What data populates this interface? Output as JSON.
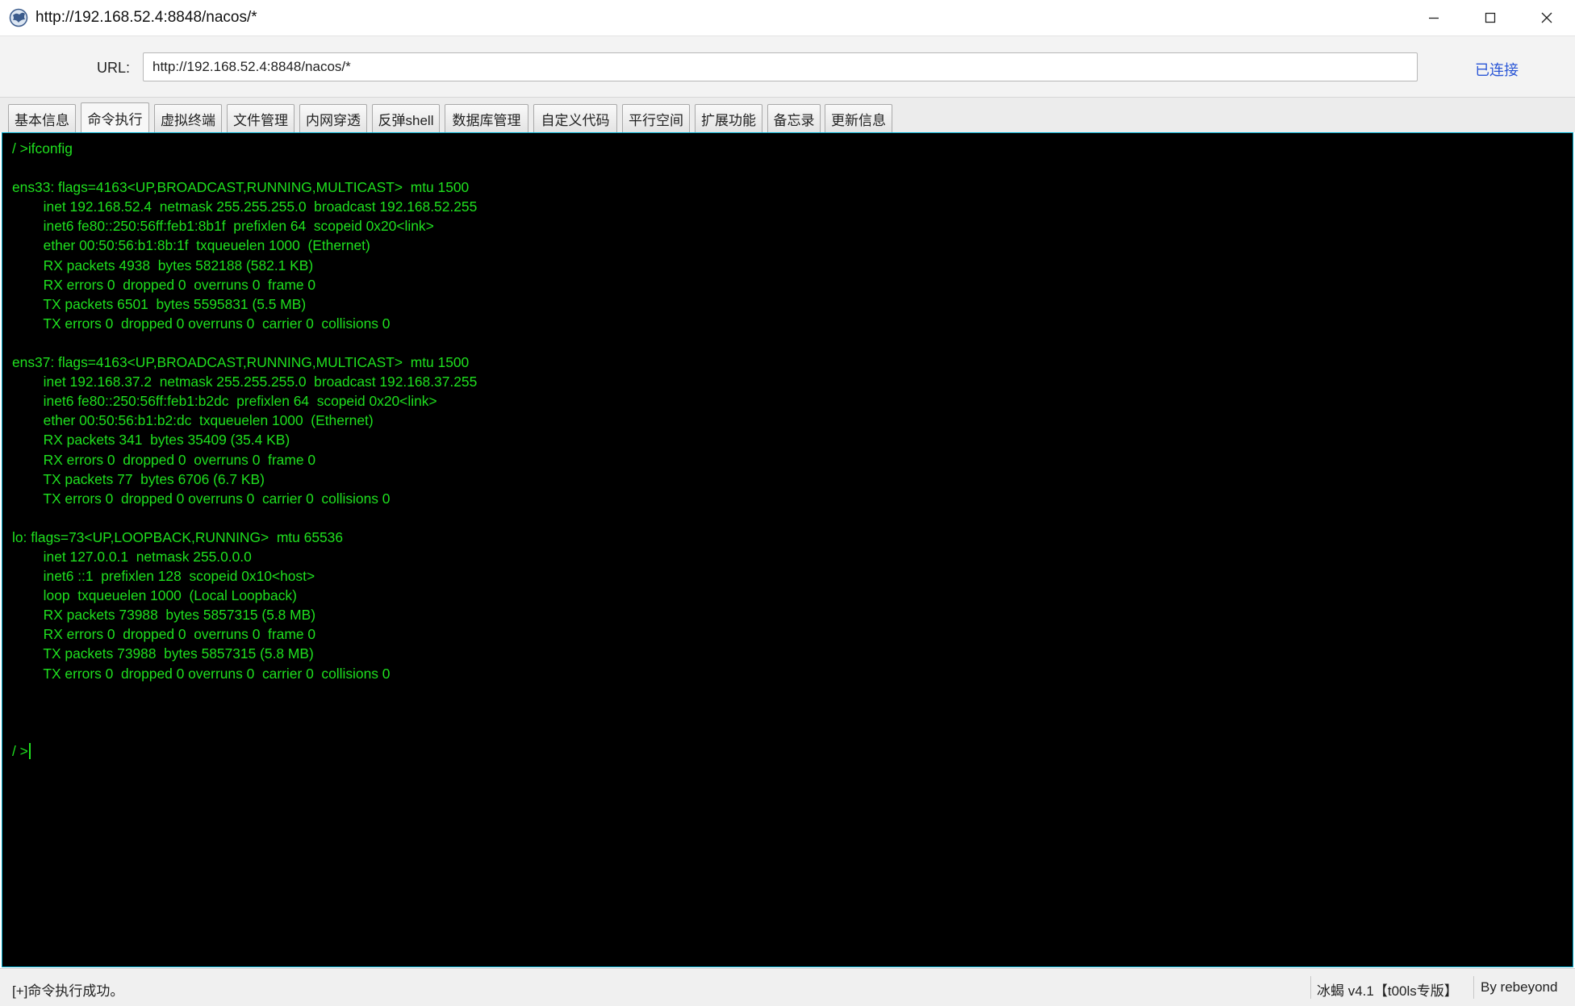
{
  "window": {
    "title": "http://192.168.52.4:8848/nacos/*",
    "icons": {
      "app": "behinder-app-icon",
      "minimize": "minimize-icon",
      "maximize": "maximize-icon",
      "close": "close-icon"
    }
  },
  "url_bar": {
    "label": "URL:",
    "value": "http://192.168.52.4:8848/nacos/*",
    "status": "已连接",
    "status_color": "#2a56d6"
  },
  "tabs": [
    {
      "label": "基本信息"
    },
    {
      "label": "命令执行",
      "active": true
    },
    {
      "label": "虚拟终端"
    },
    {
      "label": "文件管理"
    },
    {
      "label": "内网穿透"
    },
    {
      "label": "反弹shell"
    },
    {
      "label": "数据库管理"
    },
    {
      "label": "自定义代码"
    },
    {
      "label": "平行空间"
    },
    {
      "label": "扩展功能"
    },
    {
      "label": "备忘录"
    },
    {
      "label": "更新信息"
    }
  ],
  "terminal": {
    "text_color": "#1fe01f",
    "background": "#000000",
    "command_line": "/ >ifconfig",
    "output": [
      "",
      "ens33: flags=4163<UP,BROADCAST,RUNNING,MULTICAST>  mtu 1500",
      "        inet 192.168.52.4  netmask 255.255.255.0  broadcast 192.168.52.255",
      "        inet6 fe80::250:56ff:feb1:8b1f  prefixlen 64  scopeid 0x20<link>",
      "        ether 00:50:56:b1:8b:1f  txqueuelen 1000  (Ethernet)",
      "        RX packets 4938  bytes 582188 (582.1 KB)",
      "        RX errors 0  dropped 0  overruns 0  frame 0",
      "        TX packets 6501  bytes 5595831 (5.5 MB)",
      "        TX errors 0  dropped 0 overruns 0  carrier 0  collisions 0",
      "",
      "ens37: flags=4163<UP,BROADCAST,RUNNING,MULTICAST>  mtu 1500",
      "        inet 192.168.37.2  netmask 255.255.255.0  broadcast 192.168.37.255",
      "        inet6 fe80::250:56ff:feb1:b2dc  prefixlen 64  scopeid 0x20<link>",
      "        ether 00:50:56:b1:b2:dc  txqueuelen 1000  (Ethernet)",
      "        RX packets 341  bytes 35409 (35.4 KB)",
      "        RX errors 0  dropped 0  overruns 0  frame 0",
      "        TX packets 77  bytes 6706 (6.7 KB)",
      "        TX errors 0  dropped 0 overruns 0  carrier 0  collisions 0",
      "",
      "lo: flags=73<UP,LOOPBACK,RUNNING>  mtu 65536",
      "        inet 127.0.0.1  netmask 255.0.0.0",
      "        inet6 ::1  prefixlen 128  scopeid 0x10<host>",
      "        loop  txqueuelen 1000  (Local Loopback)",
      "        RX packets 73988  bytes 5857315 (5.8 MB)",
      "        RX errors 0  dropped 0  overruns 0  frame 0",
      "        TX packets 73988  bytes 5857315 (5.8 MB)",
      "        TX errors 0  dropped 0 overruns 0  carrier 0  collisions 0",
      "",
      "",
      ""
    ],
    "prompt": "/ >"
  },
  "status_bar": {
    "message": "[+]命令执行成功。",
    "version": "冰蝎 v4.1【t00ls专版】",
    "author": "By rebeyond"
  }
}
